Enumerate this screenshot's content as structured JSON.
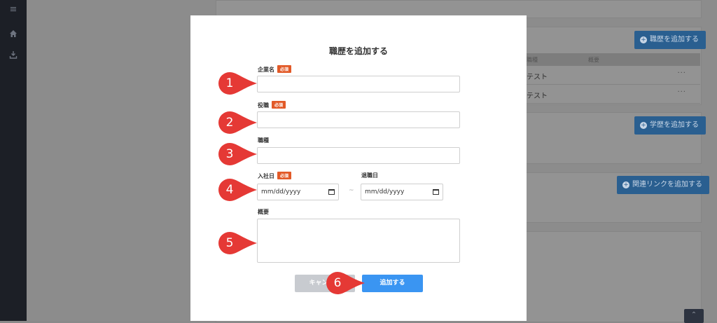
{
  "background": {
    "add_career_label": "職歴を追加する",
    "add_education_label": "学歴を追加する",
    "add_link_label": "関連リンクを追加する",
    "table_headers": [
      "職種",
      "概要"
    ],
    "table_rows": [
      {
        "text": "テスト",
        "menu": "···"
      },
      {
        "text": "テスト",
        "menu": "···"
      }
    ]
  },
  "modal": {
    "title": "職歴を追加する",
    "required_badge": "必須",
    "company_name_label": "企業名",
    "position_label": "役職",
    "job_type_label": "職種",
    "join_date_label": "入社日",
    "leave_date_label": "退職日",
    "date_placeholder": "mm/dd/yyyy",
    "date_separator": "~",
    "summary_label": "概要",
    "cancel_label": "キャンセル",
    "submit_label": "追加する"
  },
  "markers": [
    "1",
    "2",
    "3",
    "4",
    "5",
    "6"
  ],
  "colors": {
    "marker": "#e53935",
    "required_badge": "#e25a28",
    "submit_button": "#3a95f2",
    "cancel_button": "#c8cbd0"
  }
}
